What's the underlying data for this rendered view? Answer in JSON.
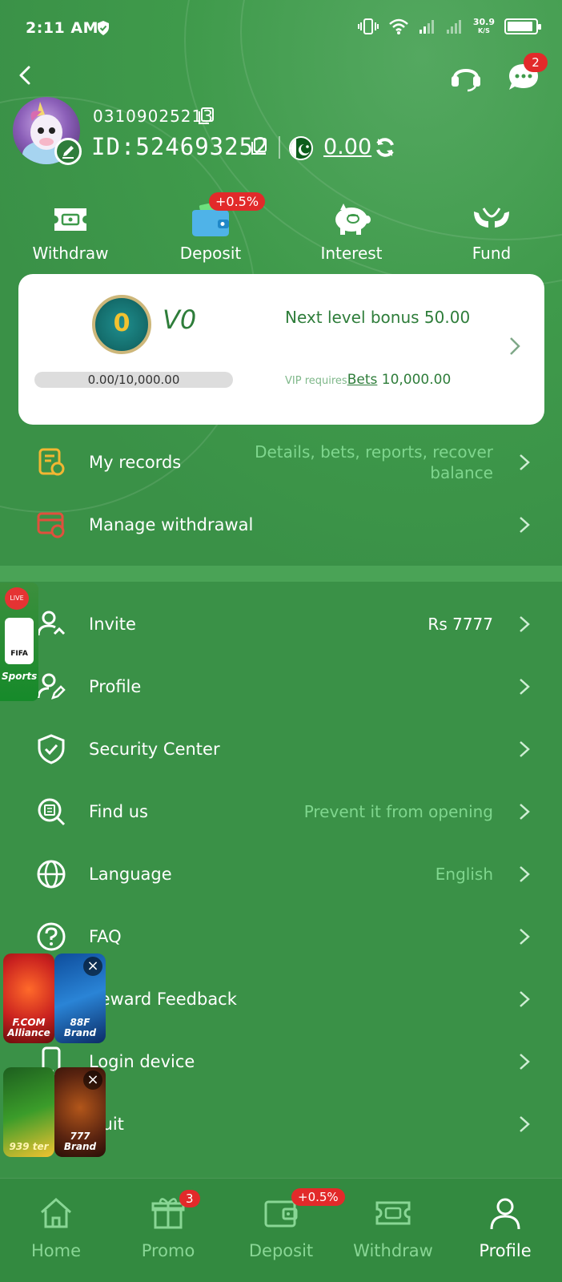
{
  "status_bar": {
    "time": "2:11 AM",
    "net_speed_value": "30.9",
    "net_speed_unit": "K/S",
    "battery_fraction": 0.9
  },
  "header": {
    "back_icon": "chevron-left-icon",
    "support_icon": "headset-icon",
    "chat_icon": "chat-icon",
    "chat_badge": "2"
  },
  "profile": {
    "phone": "03109025213",
    "uid": "ID:524693252",
    "balance": "0.00",
    "currency_flag": "pakistan-flag-icon"
  },
  "quick_actions": [
    {
      "label": "Withdraw",
      "icon": "ticket-icon"
    },
    {
      "label": "Deposit",
      "icon": "wallet-icon",
      "badge": "+0.5%"
    },
    {
      "label": "Interest",
      "icon": "piggy-bank-icon"
    },
    {
      "label": "Fund",
      "icon": "hands-icon"
    }
  ],
  "vip": {
    "medal_level": "0",
    "level": "V0",
    "next_bonus": "Next level bonus 50.00",
    "progress_text": "0.00/10,000.00",
    "progress_fraction": 0,
    "requires_label": "VIP requires",
    "requires_link": "Bets",
    "requires_amount": "10,000.00"
  },
  "menu_top": [
    {
      "label": "My records",
      "value": "Details, bets, reports, recover balance",
      "icon": "records-icon"
    },
    {
      "label": "Manage withdrawal",
      "value": "",
      "icon": "card-settings-icon"
    }
  ],
  "menu_main": [
    {
      "label": "Invite",
      "value": "Rs 7777",
      "icon": "invite-user-icon"
    },
    {
      "label": "Profile",
      "value": "",
      "icon": "user-edit-icon"
    },
    {
      "label": "Security Center",
      "value": "",
      "icon": "shield-check-icon"
    },
    {
      "label": "Find us",
      "value": "Prevent it from opening",
      "icon": "search-doc-icon"
    },
    {
      "label": "Language",
      "value": "English",
      "icon": "globe-icon"
    },
    {
      "label": "FAQ",
      "value": "",
      "icon": "question-icon"
    },
    {
      "label": "Reward Feedback",
      "value": "",
      "icon": "feedback-icon"
    },
    {
      "label": "Login device",
      "value": "",
      "icon": "device-icon"
    },
    {
      "label": "Quit",
      "value": "",
      "icon": "logout-icon"
    }
  ],
  "floating_ads": {
    "sports": {
      "live": "LIVE",
      "cup": "FIFA",
      "label": "Sports"
    },
    "ads": [
      {
        "caption": "F.COM Alliance"
      },
      {
        "caption": "88F Brand"
      },
      {
        "caption": "939 ter"
      },
      {
        "caption": "777 Brand"
      }
    ],
    "close_glyph": "×"
  },
  "bottom_nav": [
    {
      "label": "Home",
      "icon": "home-icon"
    },
    {
      "label": "Promo",
      "icon": "gift-icon",
      "badge": "3"
    },
    {
      "label": "Deposit",
      "icon": "wallet-icon",
      "badge": "+0.5%"
    },
    {
      "label": "Withdraw",
      "icon": "ticket-icon"
    },
    {
      "label": "Profile",
      "icon": "person-icon",
      "active": true
    }
  ],
  "colors": {
    "background": "#3a9147",
    "accent_light": "#7fd68e",
    "badge_red": "#e22a2a",
    "card": "#ffffff",
    "card_text": "#2e7d3a"
  }
}
